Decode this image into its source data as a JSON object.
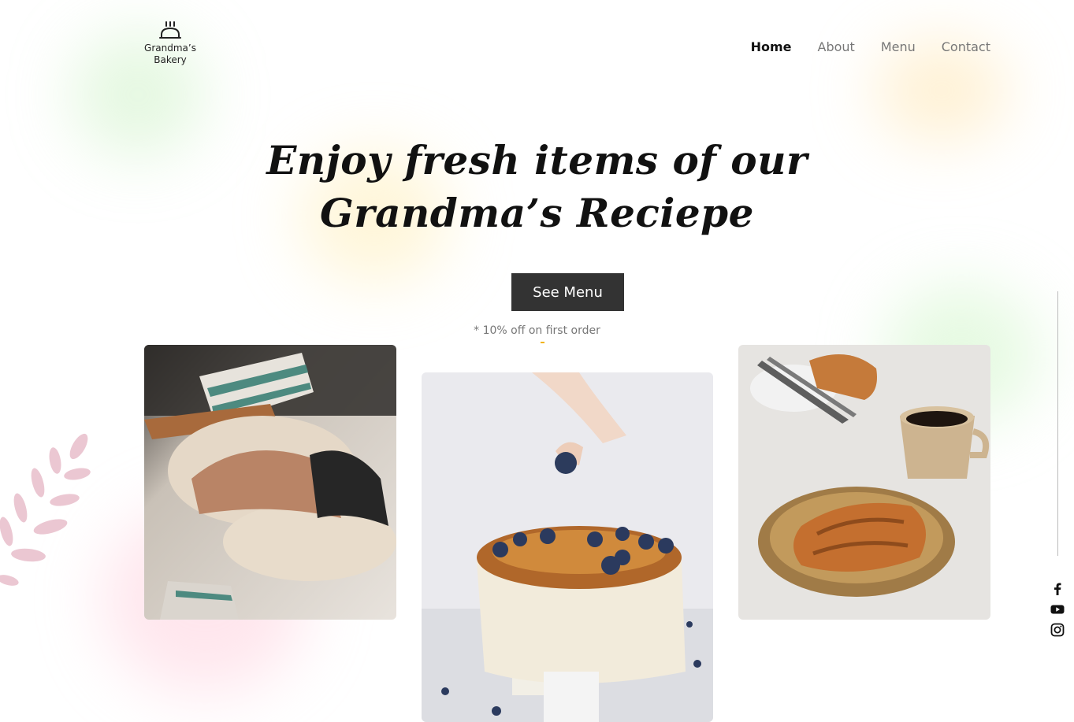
{
  "brand": {
    "logo_icon": "bread-icon",
    "name_line1": "Grandma’s",
    "name_line2": "Bakery"
  },
  "nav": {
    "items": [
      {
        "label": "Home",
        "active": true
      },
      {
        "label": "About",
        "active": false
      },
      {
        "label": "Menu",
        "active": false
      },
      {
        "label": "Contact",
        "active": false
      }
    ]
  },
  "hero": {
    "headline_line1": "Enjoy fresh items of our",
    "headline_line2": "Grandma’s Reciepe",
    "cta_label": "See Menu",
    "promo_text": "* 10% off on first order"
  },
  "gallery": {
    "images": [
      {
        "name": "dough-kneading-photo"
      },
      {
        "name": "blueberry-cake-photo"
      },
      {
        "name": "croissants-coffee-photo"
      }
    ]
  },
  "social": {
    "icons": [
      "facebook-icon",
      "youtube-icon",
      "instagram-icon"
    ]
  },
  "colors": {
    "button_bg": "#333333",
    "nav_active": "#111111",
    "nav_inactive": "#777777",
    "accent_dash": "#f2b300",
    "leaf_pink": "#e9c3cf"
  }
}
